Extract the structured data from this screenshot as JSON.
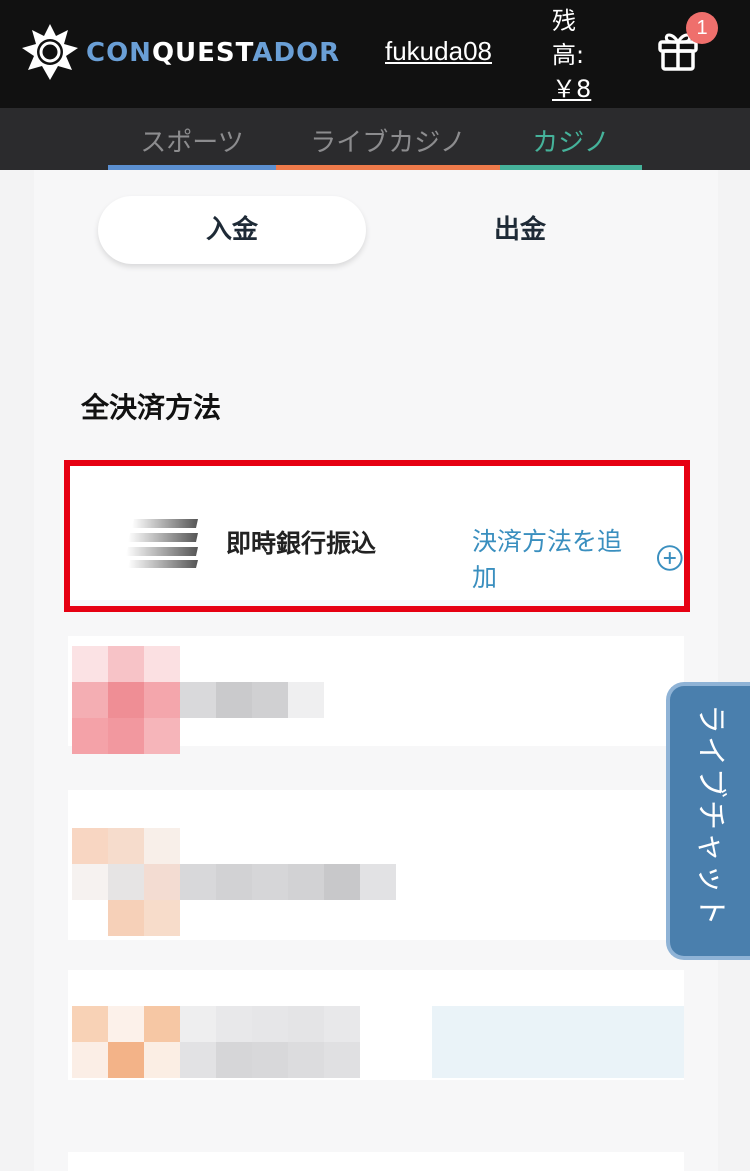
{
  "header": {
    "logo_parts": [
      "CON",
      "QUEST",
      "ADOR"
    ],
    "username": "fukuda08",
    "balance_label": "残高:",
    "balance_amount": "￥8",
    "gift_badge_count": "1",
    "gift_icon": "gift-icon"
  },
  "nav": {
    "items": [
      {
        "label": "スポーツ",
        "color": "#5b8fd0"
      },
      {
        "label": "ライブカジノ",
        "color": "#ee7a4a"
      },
      {
        "label": "カジノ",
        "color": "#45b29a"
      }
    ]
  },
  "tabs": {
    "deposit": "入金",
    "withdraw": "出金"
  },
  "section": {
    "title": "全決済方法"
  },
  "method": {
    "name": "即時銀行振込",
    "add_label": "決済方法を追加",
    "icon": "bank-transfer-icon",
    "add_icon": "plus-circle-icon",
    "highlight_color": "#e60012"
  },
  "livechat": {
    "label": "ライブチャット"
  }
}
